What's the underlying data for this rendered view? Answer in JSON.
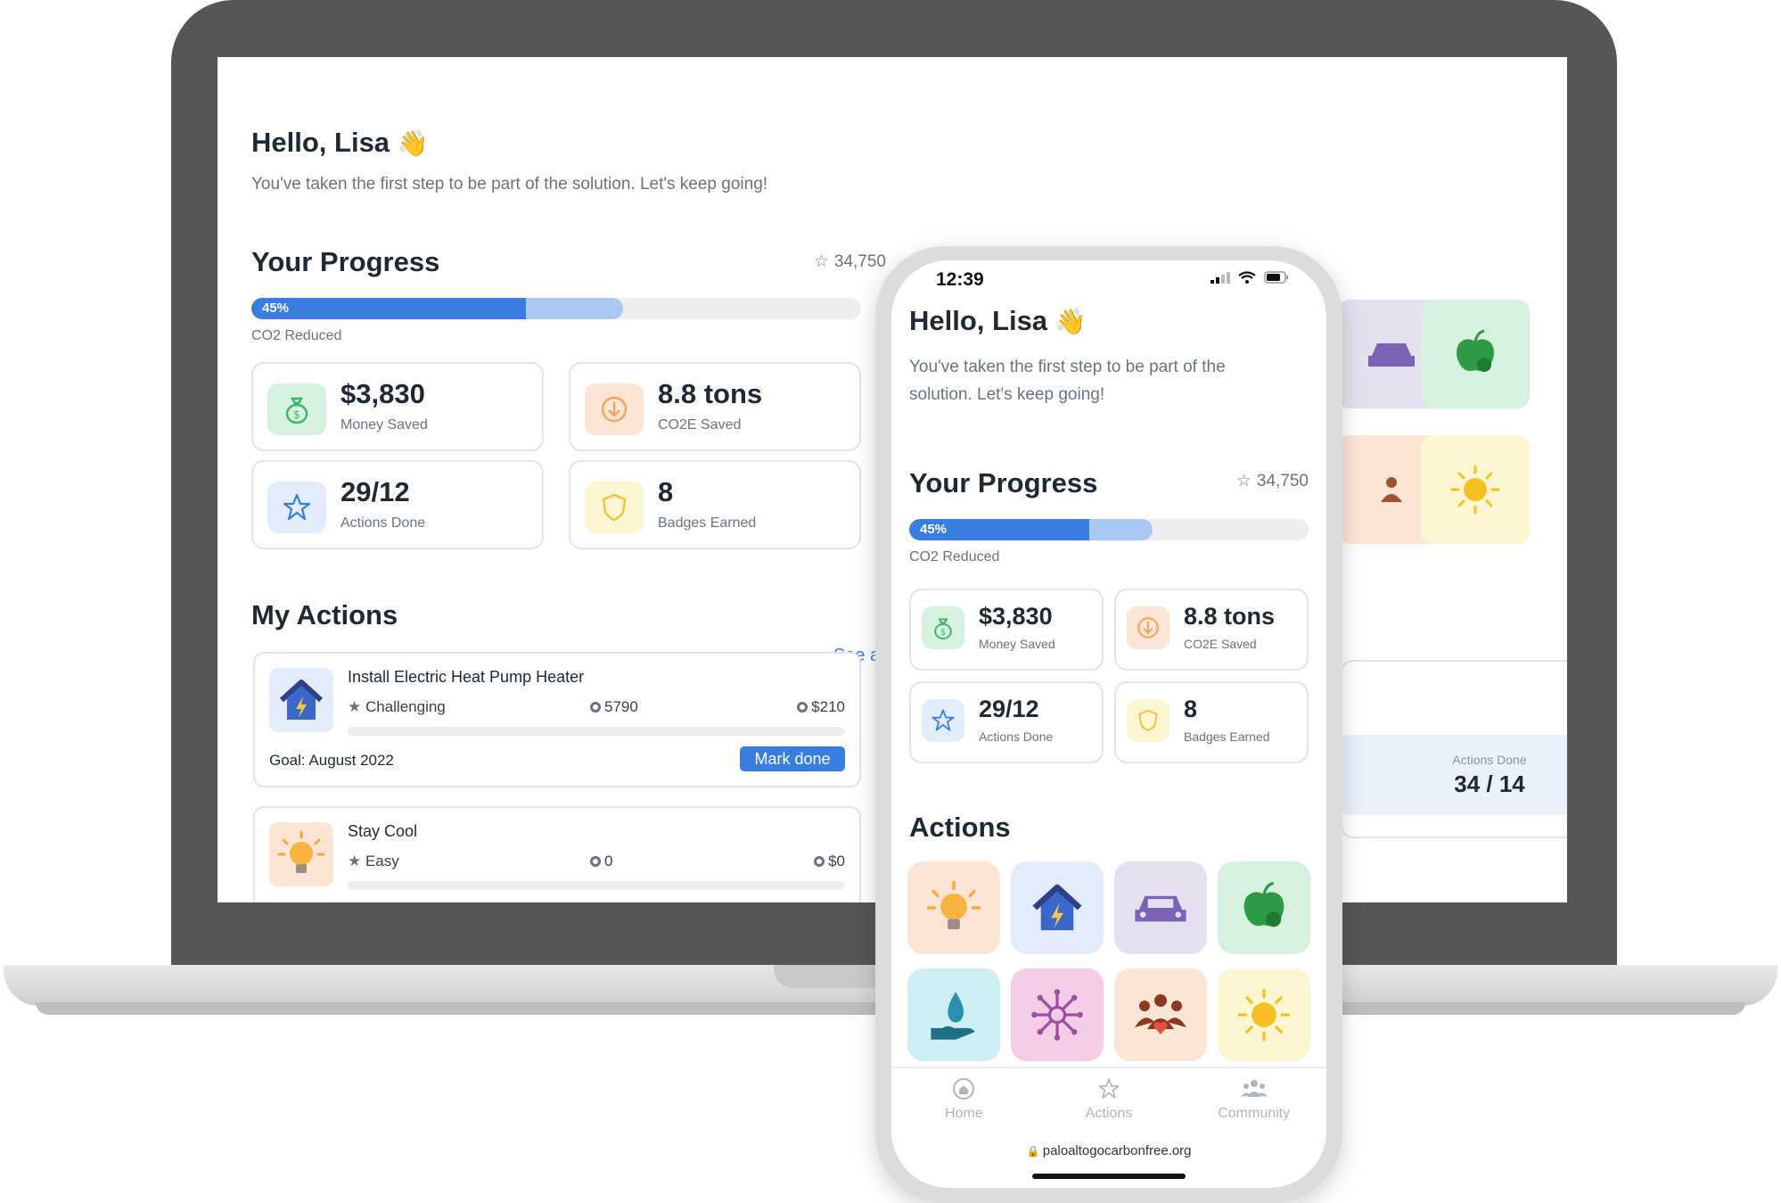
{
  "desktop": {
    "greeting": "Hello, Lisa",
    "subtitle": "You've taken the first step to be part of the solution. Let's keep going!",
    "progress_title": "Your Progress",
    "points": "34,750",
    "progress": {
      "percent_label": "45%",
      "value": 0.45,
      "secondary_value": 0.61,
      "caption": "CO2 Reduced"
    },
    "stats": [
      {
        "value": "$3,830",
        "label": "Money Saved",
        "icon": "money-bag-icon"
      },
      {
        "value": "8.8 tons",
        "label": "CO2E Saved",
        "icon": "arrow-down-circle-icon"
      },
      {
        "value": "29/12",
        "label": "Actions Done",
        "icon": "star-icon"
      },
      {
        "value": "8",
        "label": "Badges Earned",
        "icon": "shield-icon"
      }
    ],
    "actions_title": "My Actions",
    "see_all": "See all",
    "actions": [
      {
        "title": "Install Electric Heat Pump Heater",
        "difficulty": "Challenging",
        "points": "5790",
        "money": "$210",
        "goal": "Goal: August 2022",
        "button": "Mark done",
        "icon": "house-bolt-icon"
      },
      {
        "title": "Stay Cool",
        "difficulty": "Easy",
        "points": "0",
        "money": "$0",
        "icon": "lightbulb-icon"
      }
    ],
    "side_panel": {
      "label": "Actions Done",
      "value": "34 / 14"
    }
  },
  "phone": {
    "time": "12:39",
    "greeting": "Hello, Lisa",
    "subtitle": "You've taken the first step to be part of the solution. Let's keep going!",
    "progress_title": "Your Progress",
    "points": "34,750",
    "progress": {
      "percent_label": "45%",
      "value": 0.45,
      "secondary_value": 0.61,
      "caption": "CO2 Reduced"
    },
    "stats": [
      {
        "value": "$3,830",
        "label": "Money Saved"
      },
      {
        "value": "8.8 tons",
        "label": "CO2E Saved"
      },
      {
        "value": "29/12",
        "label": "Actions Done"
      },
      {
        "value": "8",
        "label": "Badges Earned"
      }
    ],
    "actions_title": "Actions",
    "action_tiles": [
      "lightbulb-icon",
      "house-bolt-icon",
      "car-icon",
      "apple-recycle-icon",
      "water-hand-icon",
      "network-icon",
      "community-heart-icon",
      "sun-icon"
    ],
    "nav": [
      {
        "label": "Home",
        "icon": "home-icon"
      },
      {
        "label": "Actions",
        "icon": "star-icon"
      },
      {
        "label": "Community",
        "icon": "people-icon"
      }
    ],
    "url": "paloaltogocarbonfree.org"
  },
  "colors": {
    "accent_blue": "#3a7de0",
    "progress_light": "#a9c8f2",
    "green_tile": "#d6f2df",
    "orange_tile": "#fde5d6",
    "blue_tile": "#e3ecfb",
    "yellow_tile": "#fdf6d3",
    "purple_tile": "#e5e0ef",
    "teal_tile": "#cdeef2",
    "pink_tile": "#f3cde5",
    "laptop_bezel": "#565656"
  }
}
